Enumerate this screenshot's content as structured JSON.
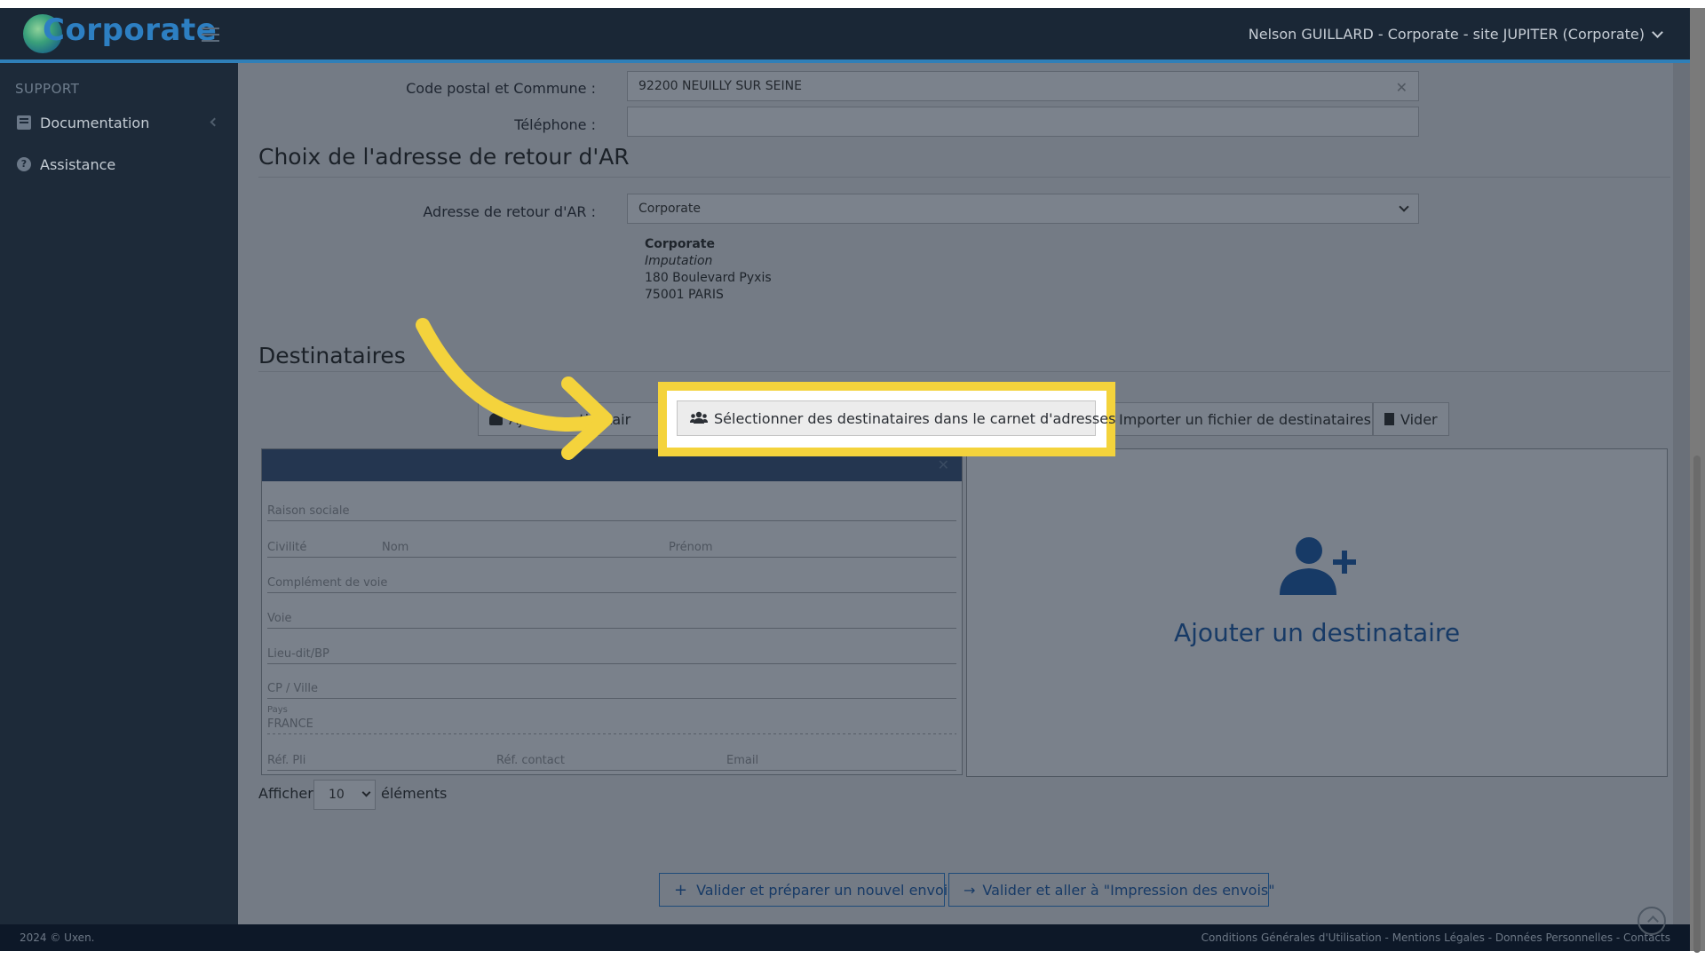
{
  "header": {
    "logo_text": "Corporate",
    "user_label": "Nelson GUILLARD - Corporate - site JUPITER (Corporate)"
  },
  "sidebar": {
    "heading": "SUPPORT",
    "items": [
      {
        "label": "Documentation",
        "icon": "book-icon"
      },
      {
        "label": "Assistance",
        "icon": "question-circle-icon"
      }
    ]
  },
  "form": {
    "postal_label": "Code postal et Commune :",
    "postal_value": "92200 NEUILLY SUR SEINE",
    "phone_label": "Téléphone :",
    "phone_value": "",
    "ar_section_title": "Choix de l'adresse de retour d'AR",
    "ar_label": "Adresse de retour d'AR :",
    "ar_value": "Corporate",
    "ar_address": {
      "name": "Corporate",
      "imputation": "Imputation",
      "street": "180 Boulevard Pyxis",
      "city": "75001 PARIS"
    }
  },
  "recipients": {
    "title": "Destinataires",
    "add_button_partial_start": "Aj",
    "add_button_partial_end": "tinatair",
    "select_button": "Sélectionner des destinataires dans le carnet d'adresses",
    "import_button": "Importer un fichier de destinataires",
    "clear_button": "Vider",
    "card": {
      "raison_sociale": "Raison sociale",
      "civilite": "Civilité",
      "nom": "Nom",
      "prenom": "Prénom",
      "complement": "Complément de voie",
      "voie": "Voie",
      "lieu_dit": "Lieu-dit/BP",
      "cp_ville": "CP / Ville",
      "pays_label": "Pays",
      "pays_value": "FRANCE",
      "ref_pli": "Réf. Pli",
      "ref_contact": "Réf. contact",
      "email": "Email"
    },
    "add_panel_title": "Ajouter un destinataire",
    "show_label": "Afficher",
    "show_value": "10",
    "show_suffix": "éléments"
  },
  "actions": {
    "validate_new": "Valider et préparer un nouvel envoi",
    "validate_print": "Valider et aller à \"Impression des envois\""
  },
  "footer": {
    "copyright": "2024 © Uxen.",
    "links": "Conditions Générales d'Utilisation - Mentions Légales - Données Personnelles - Contacts"
  },
  "colors": {
    "highlight": "#f4d33c",
    "accent_blue": "#2d7fc2",
    "dark_navy": "#1a2736"
  }
}
